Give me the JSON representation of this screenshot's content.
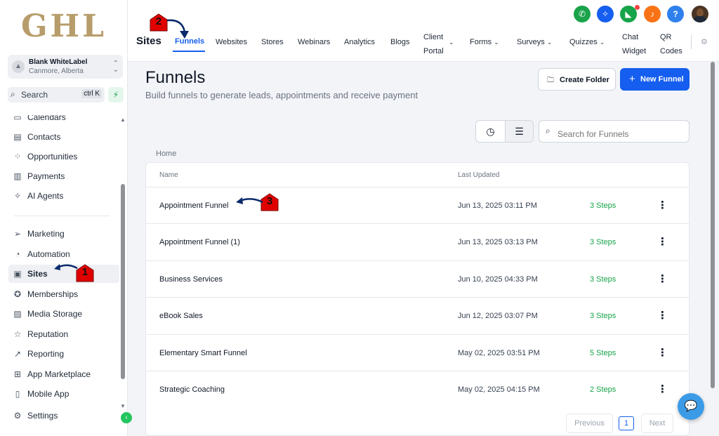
{
  "logo": {
    "text": "GHL"
  },
  "account": {
    "name": "Blank WhiteLabel",
    "location": "Canmore, Alberta"
  },
  "sidebar_search": {
    "label": "Search",
    "shortcut": "ctrl K"
  },
  "sidebar": {
    "items": [
      {
        "label": "Calendars",
        "icon": "calendar-icon"
      },
      {
        "label": "Contacts",
        "icon": "contacts-icon"
      },
      {
        "label": "Opportunities",
        "icon": "opportunities-icon"
      },
      {
        "label": "Payments",
        "icon": "payments-icon"
      },
      {
        "label": "AI Agents",
        "icon": "ai-agents-icon"
      },
      {
        "label": "Marketing",
        "icon": "marketing-icon"
      },
      {
        "label": "Automation",
        "icon": "automation-icon"
      },
      {
        "label": "Sites",
        "icon": "sites-icon"
      },
      {
        "label": "Memberships",
        "icon": "memberships-icon"
      },
      {
        "label": "Media Storage",
        "icon": "media-storage-icon"
      },
      {
        "label": "Reputation",
        "icon": "reputation-icon"
      },
      {
        "label": "Reporting",
        "icon": "reporting-icon"
      },
      {
        "label": "App Marketplace",
        "icon": "app-marketplace-icon"
      },
      {
        "label": "Mobile App",
        "icon": "mobile-app-icon"
      },
      {
        "label": "Settings",
        "icon": "settings-icon"
      }
    ]
  },
  "topbar": {
    "section": "Sites",
    "tabs": [
      {
        "label": "Funnels"
      },
      {
        "label": "Websites"
      },
      {
        "label": "Stores"
      },
      {
        "label": "Webinars"
      },
      {
        "label": "Analytics"
      },
      {
        "label": "Blogs"
      },
      {
        "label_line1": "Client",
        "label_line2": "Portal"
      },
      {
        "label": "Forms"
      },
      {
        "label": "Surveys"
      },
      {
        "label": "Quizzes"
      },
      {
        "label_line1": "Chat",
        "label_line2": "Widget"
      },
      {
        "label_line1": "QR",
        "label_line2": "Codes"
      }
    ],
    "header_icons": [
      {
        "name": "phone-icon",
        "color": "#1aa34a"
      },
      {
        "name": "magic-icon",
        "color": "#155eef"
      },
      {
        "name": "megaphone-icon",
        "color": "#16a34a"
      },
      {
        "name": "bell-icon",
        "color": "#f97316"
      },
      {
        "name": "help-icon",
        "color": "#2f80ed"
      }
    ]
  },
  "main": {
    "title": "Funnels",
    "subtitle": "Build funnels to generate leads, appointments and receive payment",
    "create_folder_label": "Create Folder",
    "new_funnel_label": "New Funnel",
    "search_placeholder": "Search for Funnels",
    "breadcrumb": "Home"
  },
  "table": {
    "columns": {
      "name": "Name",
      "updated": "Last Updated"
    },
    "rows": [
      {
        "name": "Appointment Funnel",
        "updated": "Jun 13, 2025 03:11 PM",
        "steps": "3 Steps"
      },
      {
        "name": "Appointment Funnel (1)",
        "updated": "Jun 13, 2025 03:13 PM",
        "steps": "3 Steps"
      },
      {
        "name": "Business Services",
        "updated": "Jun 10, 2025 04:33 PM",
        "steps": "3 Steps"
      },
      {
        "name": "eBook Sales",
        "updated": "Jun 12, 2025 03:07 PM",
        "steps": "3 Steps"
      },
      {
        "name": "Elementary Smart Funnel",
        "updated": "May 02, 2025 03:51 PM",
        "steps": "5 Steps"
      },
      {
        "name": "Strategic Coaching",
        "updated": "May 02, 2025 04:15 PM",
        "steps": "2 Steps"
      }
    ]
  },
  "pagination": {
    "previous": "Previous",
    "page": "1",
    "next": "Next"
  },
  "annotations": {
    "step1": "1",
    "step2": "2",
    "step3": "3",
    "marker_color": "#e00000",
    "arrow_color": "#0b2a6b"
  }
}
